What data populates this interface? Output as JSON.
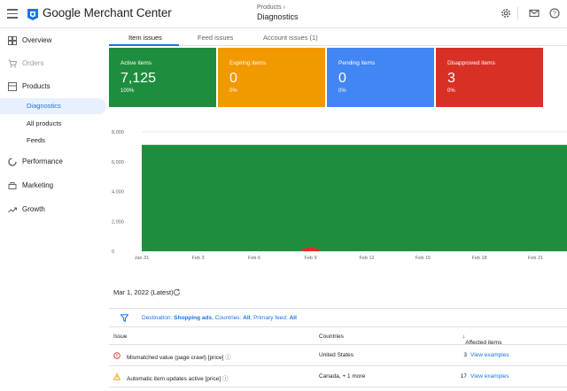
{
  "header": {
    "brand": "Google Merchant Center",
    "breadcrumb": "Products ›",
    "page_title": "Diagnostics"
  },
  "sidebar": {
    "items": [
      {
        "label": "Overview",
        "icon": "dashboard-icon"
      },
      {
        "label": "Orders",
        "icon": "cart-icon"
      },
      {
        "label": "Products",
        "icon": "products-icon"
      },
      {
        "label": "Diagnostics"
      },
      {
        "label": "All products"
      },
      {
        "label": "Feeds"
      },
      {
        "label": "Performance",
        "icon": "performance-icon"
      },
      {
        "label": "Marketing",
        "icon": "marketing-icon"
      },
      {
        "label": "Growth",
        "icon": "growth-icon"
      }
    ]
  },
  "tabs": [
    {
      "label": "Item issues"
    },
    {
      "label": "Feed issues"
    },
    {
      "label": "Account issues (1)"
    }
  ],
  "cards": [
    {
      "title": "Active items",
      "value": "7,125",
      "pct": "100%",
      "color": "#1e8e3e"
    },
    {
      "title": "Expiring items",
      "value": "0",
      "pct": "0%",
      "color": "#f29900"
    },
    {
      "title": "Pending items",
      "value": "0",
      "pct": "0%",
      "color": "#4285f4"
    },
    {
      "title": "Disapproved items",
      "value": "3",
      "pct": "0%",
      "color": "#d93025"
    }
  ],
  "chart_data": {
    "type": "area",
    "x": [
      "Jan 31",
      "Feb 3",
      "Feb 6",
      "Feb 9",
      "Feb 12",
      "Feb 15",
      "Feb 18",
      "Feb 21"
    ],
    "yticks": [
      "8,000",
      "6,000",
      "4,000",
      "2,000",
      "0"
    ],
    "ylim": [
      0,
      8000
    ],
    "series": [
      {
        "values": [
          7125,
          7125,
          7125,
          7125,
          7125,
          7125,
          7125,
          7125
        ],
        "color": "#1e8e3e"
      },
      {
        "values": [
          0,
          0,
          0,
          350,
          0,
          0,
          0,
          0
        ],
        "color": "#d93025"
      }
    ],
    "grid": true
  },
  "date_label": "Mar 1, 2022 (Latest)",
  "filter": {
    "prefix": "Destination: ",
    "destination": "Shopping ads",
    "countries_label": ", Countries: ",
    "countries": "All",
    "feed_label": "; Primary feed: ",
    "feed": "All"
  },
  "table": {
    "headers": {
      "issue": "Issue",
      "countries": "Countries",
      "affected": "Affected items"
    },
    "rows": [
      {
        "issue": "Mismatched value (page crawl) [price]",
        "countries": "United States",
        "count": "3",
        "action": "View examples",
        "severity": "error"
      },
      {
        "issue": "Automatic item updates active [price]",
        "countries": "Canada, + 1 more",
        "count": "17",
        "action": "View examples",
        "severity": "warning"
      }
    ]
  }
}
